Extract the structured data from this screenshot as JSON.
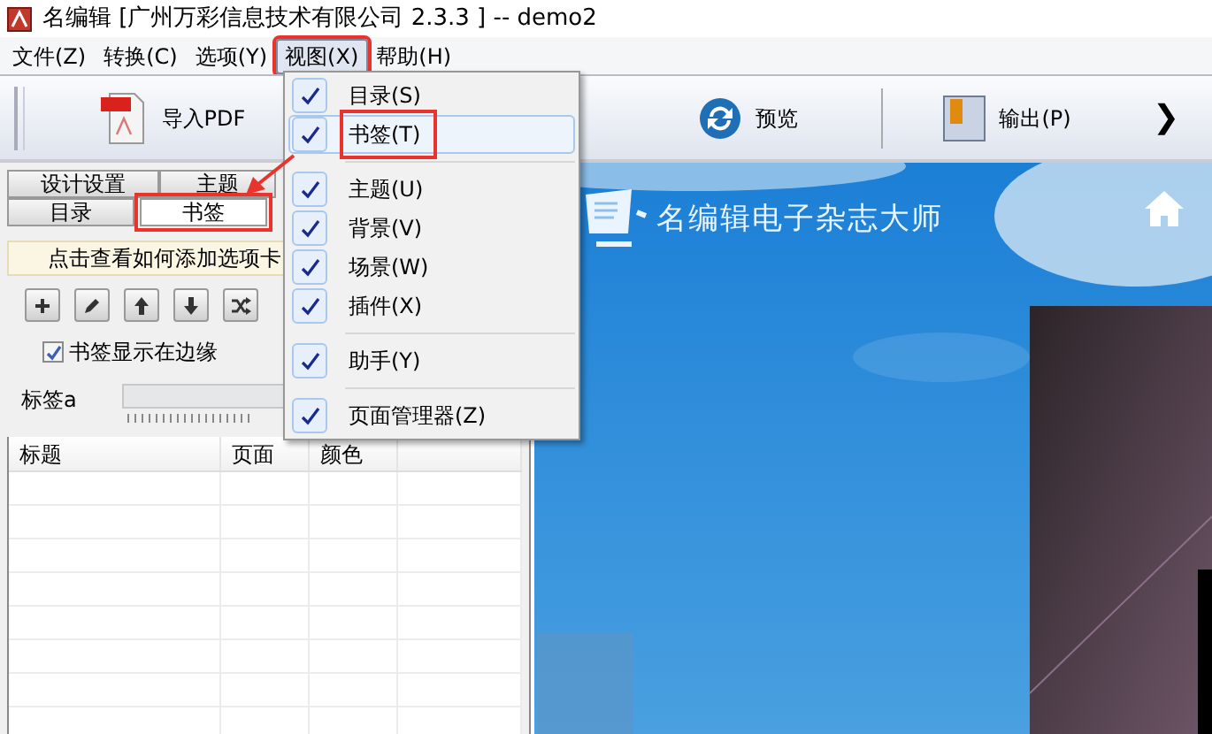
{
  "window": {
    "title": "名编辑 [广州万彩信息技术有限公司 2.3.3 ] -- demo2"
  },
  "menu_bar": [
    {
      "label": "文件(Z)",
      "selected": false,
      "highlighted": false
    },
    {
      "label": "转换(C)",
      "selected": false,
      "highlighted": false
    },
    {
      "label": "选项(Y)",
      "selected": false,
      "highlighted": false
    },
    {
      "label": "视图(X)",
      "selected": true,
      "highlighted": true
    },
    {
      "label": "帮助(H)",
      "selected": false,
      "highlighted": false
    }
  ],
  "toolbar": [
    {
      "kind": "pdf",
      "label": "导入PDF"
    },
    {
      "kind": "hidden"
    },
    {
      "kind": "refresh",
      "label": "预览"
    },
    {
      "kind": "export",
      "label": "输出(P)"
    },
    {
      "kind": "more",
      "label": "❯"
    }
  ],
  "left_panel": {
    "tab_rows": [
      {
        "tabs": [
          {
            "label": "设计设置",
            "selected": false,
            "highlighted": false
          },
          {
            "label": "主题",
            "selected": false,
            "highlighted": false
          }
        ]
      },
      {
        "tabs": [
          {
            "label": "目录",
            "selected": false,
            "highlighted": false
          },
          {
            "label": "书签",
            "selected": true,
            "highlighted": true
          }
        ]
      }
    ],
    "help_link": "点击查看如何添加选项卡",
    "tools": [
      {
        "kind": "add"
      },
      {
        "kind": "edit"
      },
      {
        "kind": "up"
      },
      {
        "kind": "down"
      },
      {
        "kind": "shuffle"
      }
    ],
    "checkbox": {
      "label": "书签显示在边缘",
      "checked": true
    },
    "label_row": {
      "label": "标签a"
    },
    "table": {
      "columns": [
        "标题",
        "页面",
        "颜色"
      ]
    }
  },
  "view_menu": {
    "items": [
      {
        "kind": "item",
        "label": "目录(S)",
        "checked": true,
        "selected": false,
        "highlighted": false
      },
      {
        "kind": "item",
        "label": "书签(T)",
        "checked": true,
        "selected": true,
        "highlighted": true
      },
      {
        "kind": "separator"
      },
      {
        "kind": "item",
        "label": "主题(U)",
        "checked": true,
        "selected": false,
        "highlighted": false
      },
      {
        "kind": "item",
        "label": "背景(V)",
        "checked": true,
        "selected": false,
        "highlighted": false
      },
      {
        "kind": "item",
        "label": "场景(W)",
        "checked": true,
        "selected": false,
        "highlighted": false
      },
      {
        "kind": "item",
        "label": "插件(X)",
        "checked": true,
        "selected": false,
        "highlighted": false
      },
      {
        "kind": "separator"
      },
      {
        "kind": "item",
        "label": "助手(Y)",
        "checked": true,
        "selected": false,
        "highlighted": false
      },
      {
        "kind": "separator"
      },
      {
        "kind": "item",
        "label": "页面管理器(Z)",
        "checked": true,
        "selected": false,
        "highlighted": false
      }
    ]
  },
  "preview": {
    "logo_text": "名编辑电子杂志大师"
  },
  "annotation_arrow": true
}
